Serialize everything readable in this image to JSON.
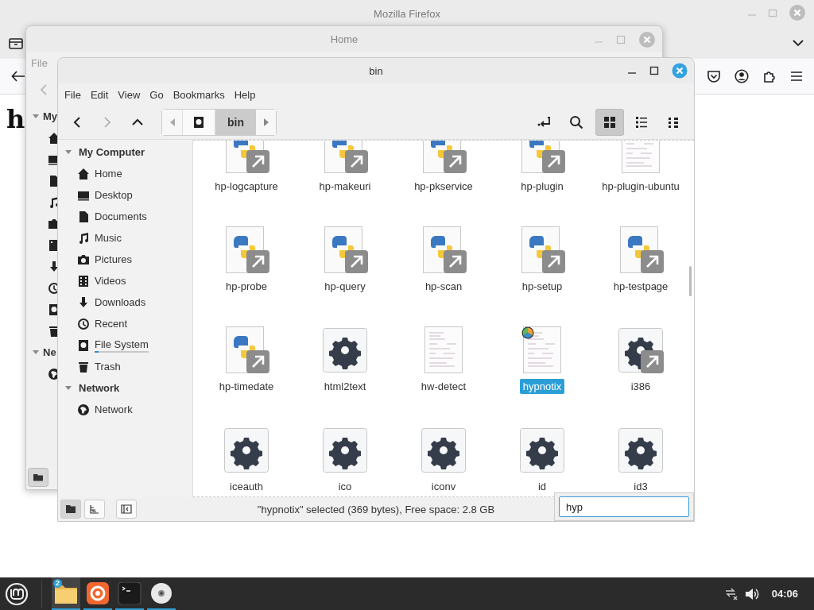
{
  "firefox": {
    "title": "Mozilla Firefox",
    "page_heading": "h"
  },
  "home_window": {
    "title": "Home",
    "menu": [
      "File"
    ],
    "sections": [
      {
        "label": "My",
        "expanded": true,
        "children": [
          {
            "kind": "home"
          },
          {
            "kind": "desktop"
          },
          {
            "kind": "documents"
          },
          {
            "kind": "music"
          },
          {
            "kind": "pictures"
          },
          {
            "kind": "videos"
          },
          {
            "kind": "downloads"
          },
          {
            "kind": "recent"
          },
          {
            "kind": "drive"
          },
          {
            "kind": "trash"
          }
        ]
      },
      {
        "label": "Ne",
        "expanded": true,
        "children": [
          {
            "kind": "network"
          }
        ]
      }
    ]
  },
  "bin_window": {
    "title": "bin",
    "menu": [
      "File",
      "Edit",
      "View",
      "Go",
      "Bookmarks",
      "Help"
    ],
    "nav": [
      {
        "kind": "back",
        "disabled": false
      },
      {
        "kind": "forward",
        "disabled": true
      },
      {
        "kind": "up",
        "disabled": false
      }
    ],
    "path": [
      {
        "kind": "drive",
        "selected": false
      },
      {
        "kind": "folder",
        "label": "bin",
        "selected": true
      }
    ],
    "views": [
      {
        "kind": "icons",
        "selected": true
      },
      {
        "kind": "list",
        "selected": false
      },
      {
        "kind": "compact",
        "selected": false
      }
    ],
    "sidebar": [
      {
        "label": "My Computer",
        "expanded": true,
        "children": [
          {
            "kind": "home",
            "label": "Home"
          },
          {
            "kind": "desktop",
            "label": "Desktop"
          },
          {
            "kind": "documents",
            "label": "Documents"
          },
          {
            "kind": "music",
            "label": "Music"
          },
          {
            "kind": "pictures",
            "label": "Pictures"
          },
          {
            "kind": "videos",
            "label": "Videos"
          },
          {
            "kind": "downloads",
            "label": "Downloads"
          },
          {
            "kind": "recent",
            "label": "Recent"
          },
          {
            "kind": "drive",
            "label": "File System",
            "level": 0.08
          },
          {
            "kind": "trash",
            "label": "Trash"
          }
        ]
      },
      {
        "label": "Network",
        "expanded": true,
        "children": [
          {
            "kind": "network",
            "label": "Network"
          }
        ]
      }
    ],
    "files": [
      {
        "name": "hp-logcapture",
        "kind": "python-link",
        "selected": false
      },
      {
        "name": "hp-makeuri",
        "kind": "python-link",
        "selected": false
      },
      {
        "name": "hp-pkservice",
        "kind": "python-link",
        "selected": false
      },
      {
        "name": "hp-plugin",
        "kind": "python-link",
        "selected": false
      },
      {
        "name": "hp-plugin-ubuntu",
        "kind": "text",
        "selected": false
      },
      {
        "name": "hp-probe",
        "kind": "python-link",
        "selected": false
      },
      {
        "name": "hp-query",
        "kind": "python-link",
        "selected": false
      },
      {
        "name": "hp-scan",
        "kind": "python-link",
        "selected": false
      },
      {
        "name": "hp-setup",
        "kind": "python-link",
        "selected": false
      },
      {
        "name": "hp-testpage",
        "kind": "python-link",
        "selected": false
      },
      {
        "name": "hp-timedate",
        "kind": "python-link",
        "selected": false
      },
      {
        "name": "html2text",
        "kind": "binary",
        "selected": false
      },
      {
        "name": "hw-detect",
        "kind": "text",
        "selected": false
      },
      {
        "name": "hypnotix",
        "kind": "app-script",
        "selected": true
      },
      {
        "name": "i386",
        "kind": "binary-link",
        "selected": false
      },
      {
        "name": "iceauth",
        "kind": "binary",
        "selected": false
      },
      {
        "name": "ico",
        "kind": "binary",
        "selected": false
      },
      {
        "name": "iconv",
        "kind": "binary",
        "selected": false
      },
      {
        "name": "id",
        "kind": "binary",
        "selected": false
      },
      {
        "name": "id3",
        "kind": "binary",
        "selected": false
      }
    ],
    "status_buttons": [
      {
        "kind": "places",
        "selected": true
      },
      {
        "kind": "tree",
        "selected": false
      },
      {
        "kind": "sidebar",
        "selected": false
      }
    ],
    "status": "\"hypnotix\" selected (369 bytes), Free space: 2.8 GB",
    "search": {
      "value": "hyp"
    }
  },
  "taskbar": {
    "apps": [
      {
        "kind": "files",
        "badge": "2",
        "selected": true
      },
      {
        "kind": "firefox",
        "selected": false
      },
      {
        "kind": "terminal",
        "selected": false
      },
      {
        "kind": "disc",
        "selected": false
      }
    ],
    "clock": "04:06"
  }
}
